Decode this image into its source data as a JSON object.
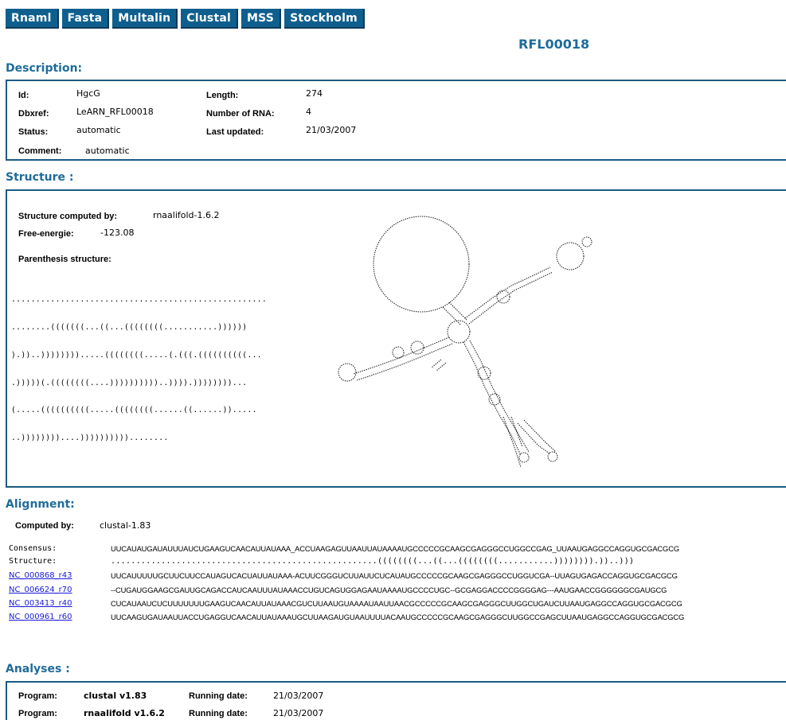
{
  "tabs": [
    "Rnaml",
    "Fasta",
    "Multalin",
    "Clustal",
    "MSS",
    "Stockholm"
  ],
  "page_title": "RFL00018",
  "sections": {
    "description": "Description:",
    "structure": "Structure :",
    "alignment": "Alignment:",
    "analyses": "Analyses :"
  },
  "description": {
    "id_label": "Id:",
    "id": "HgcG",
    "dbxref_label": "Dbxref:",
    "dbxref": "LeARN_RFL00018",
    "status_label": "Status:",
    "status": "automatic",
    "comment_label": "Comment:",
    "comment": "automatic",
    "length_label": "Length:",
    "length": "274",
    "num_rna_label": "Number of RNA:",
    "num_rna": "4",
    "last_updated_label": "Last updated:",
    "last_updated": "21/03/2007"
  },
  "structure": {
    "computed_by_label": "Structure computed by:",
    "computed_by": "rnaalifold-1.6.2",
    "free_energy_label": "Free-energie:",
    "free_energy": "-123.08",
    "parenthesis_label": "Parenthesis structure:",
    "parenthesis_lines": [
      "....................................................",
      "........(((((((...((...((((((((...........))))))",
      ").))..)))))))).....((((((((.....(.(((.((((((((((...",
      ".)))))(.((((((((....))))))))))..)))).))))))))...",
      "(.....((((((((((.....((((((((......((......)).....",
      "..))))))))....))))))))))........"
    ]
  },
  "alignment": {
    "computed_by_label": "Computed by:",
    "computed_by": "clustal-1.83",
    "rows": [
      {
        "label": "Consensus:",
        "seq": "UUCAUAUGAUAUUUAUCUGAAGUCAACAUUAUAAA_ACCUAAGAGUUAAUUAUAAAAUGCCCCCGCAAGCGAGGGCCUGGCCGAG_UUAAUGAGGCCAGGUGCGACGCG",
        "link": false,
        "struct": false
      },
      {
        "label": "Structure:",
        "seq": ".....................................................((((((((...((...((((((((...........)))))))).))..)))",
        "link": false,
        "struct": true
      },
      {
        "label": "NC_000868_r43",
        "seq": "UUCAUUUUUGCUUCUUCCAUAGUCACUAUUAUAAA-ACUUCGGGUCUUAUUCUCAUAUGCCCCCGCAAGCGAGGGCCUGGUCGA--UUAGUGAGACCAGGUGCGACGCG",
        "link": true,
        "struct": false
      },
      {
        "label": "NC_006624_r70",
        "seq": "--CUGAUGGAAGCGAUUGCAGACCAUCAAUUUAUAAACCUGUCAGUGGAGAAUAAAAUGCCCCUGC--GCGAGGACCCCGGGGAG---AAUGAACCGGGGGGCGAUGCG",
        "link": true,
        "struct": false
      },
      {
        "label": "NC_003413_r40",
        "seq": "CUCAUAAUCUCUUUUUUUGAAGUCAACAUUAUAAACGUCUUAAUGUAAAAUAAUUAACGCCCCCGCAAGCGAGGGCUUGGCUGAUCUUAAUGAGGCCAGGUGCGACGCG",
        "link": true,
        "struct": false
      },
      {
        "label": "NC_000961_r60",
        "seq": "UUCAAGUGAUAAUUACCUGAGGUCAACAUUAUAAAUGCUUAAGAUGUAAUUUUACAAUGCCCCCGCAAGCGAGGGCUUGGCCGAGCUUAAUGAGGCCAGGUGCGACGCG",
        "link": true,
        "struct": false
      }
    ]
  },
  "analyses": [
    {
      "program_label": "Program:",
      "program": "clustal v1.83",
      "date_label": "Running date:",
      "date": "21/03/2007"
    },
    {
      "program_label": "Program:",
      "program": "rnaalifold v1.6.2",
      "date_label": "Running date:",
      "date": "21/03/2007"
    }
  ],
  "colors": {
    "accent": "#1f6c9a",
    "tab_bg": "#0e5f8e",
    "link": "#1a1ad8"
  },
  "diagram_icon": "rna-secondary-structure-drawing"
}
